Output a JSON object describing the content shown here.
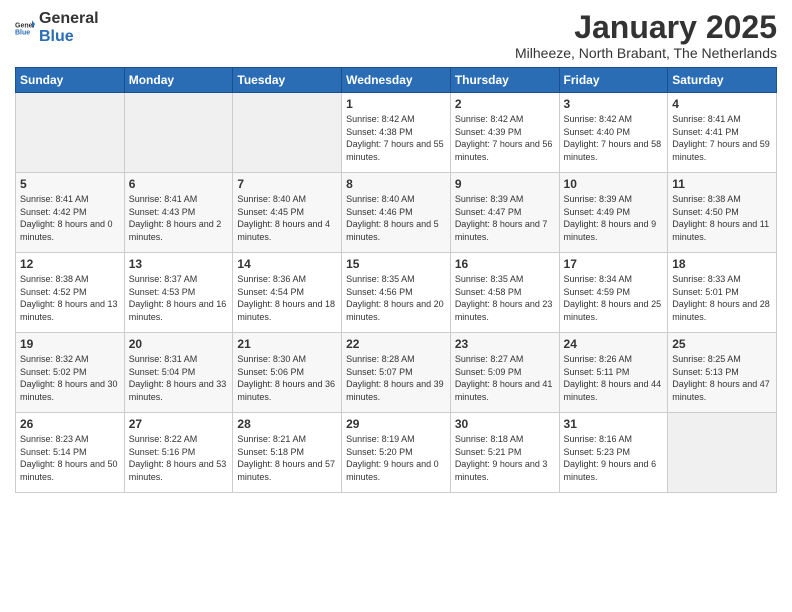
{
  "logo": {
    "general": "General",
    "blue": "Blue"
  },
  "header": {
    "month": "January 2025",
    "location": "Milheeze, North Brabant, The Netherlands"
  },
  "weekdays": [
    "Sunday",
    "Monday",
    "Tuesday",
    "Wednesday",
    "Thursday",
    "Friday",
    "Saturday"
  ],
  "weeks": [
    [
      {
        "day": "",
        "sunrise": "",
        "sunset": "",
        "daylight": ""
      },
      {
        "day": "",
        "sunrise": "",
        "sunset": "",
        "daylight": ""
      },
      {
        "day": "",
        "sunrise": "",
        "sunset": "",
        "daylight": ""
      },
      {
        "day": "1",
        "sunrise": "Sunrise: 8:42 AM",
        "sunset": "Sunset: 4:38 PM",
        "daylight": "Daylight: 7 hours and 55 minutes."
      },
      {
        "day": "2",
        "sunrise": "Sunrise: 8:42 AM",
        "sunset": "Sunset: 4:39 PM",
        "daylight": "Daylight: 7 hours and 56 minutes."
      },
      {
        "day": "3",
        "sunrise": "Sunrise: 8:42 AM",
        "sunset": "Sunset: 4:40 PM",
        "daylight": "Daylight: 7 hours and 58 minutes."
      },
      {
        "day": "4",
        "sunrise": "Sunrise: 8:41 AM",
        "sunset": "Sunset: 4:41 PM",
        "daylight": "Daylight: 7 hours and 59 minutes."
      }
    ],
    [
      {
        "day": "5",
        "sunrise": "Sunrise: 8:41 AM",
        "sunset": "Sunset: 4:42 PM",
        "daylight": "Daylight: 8 hours and 0 minutes."
      },
      {
        "day": "6",
        "sunrise": "Sunrise: 8:41 AM",
        "sunset": "Sunset: 4:43 PM",
        "daylight": "Daylight: 8 hours and 2 minutes."
      },
      {
        "day": "7",
        "sunrise": "Sunrise: 8:40 AM",
        "sunset": "Sunset: 4:45 PM",
        "daylight": "Daylight: 8 hours and 4 minutes."
      },
      {
        "day": "8",
        "sunrise": "Sunrise: 8:40 AM",
        "sunset": "Sunset: 4:46 PM",
        "daylight": "Daylight: 8 hours and 5 minutes."
      },
      {
        "day": "9",
        "sunrise": "Sunrise: 8:39 AM",
        "sunset": "Sunset: 4:47 PM",
        "daylight": "Daylight: 8 hours and 7 minutes."
      },
      {
        "day": "10",
        "sunrise": "Sunrise: 8:39 AM",
        "sunset": "Sunset: 4:49 PM",
        "daylight": "Daylight: 8 hours and 9 minutes."
      },
      {
        "day": "11",
        "sunrise": "Sunrise: 8:38 AM",
        "sunset": "Sunset: 4:50 PM",
        "daylight": "Daylight: 8 hours and 11 minutes."
      }
    ],
    [
      {
        "day": "12",
        "sunrise": "Sunrise: 8:38 AM",
        "sunset": "Sunset: 4:52 PM",
        "daylight": "Daylight: 8 hours and 13 minutes."
      },
      {
        "day": "13",
        "sunrise": "Sunrise: 8:37 AM",
        "sunset": "Sunset: 4:53 PM",
        "daylight": "Daylight: 8 hours and 16 minutes."
      },
      {
        "day": "14",
        "sunrise": "Sunrise: 8:36 AM",
        "sunset": "Sunset: 4:54 PM",
        "daylight": "Daylight: 8 hours and 18 minutes."
      },
      {
        "day": "15",
        "sunrise": "Sunrise: 8:35 AM",
        "sunset": "Sunset: 4:56 PM",
        "daylight": "Daylight: 8 hours and 20 minutes."
      },
      {
        "day": "16",
        "sunrise": "Sunrise: 8:35 AM",
        "sunset": "Sunset: 4:58 PM",
        "daylight": "Daylight: 8 hours and 23 minutes."
      },
      {
        "day": "17",
        "sunrise": "Sunrise: 8:34 AM",
        "sunset": "Sunset: 4:59 PM",
        "daylight": "Daylight: 8 hours and 25 minutes."
      },
      {
        "day": "18",
        "sunrise": "Sunrise: 8:33 AM",
        "sunset": "Sunset: 5:01 PM",
        "daylight": "Daylight: 8 hours and 28 minutes."
      }
    ],
    [
      {
        "day": "19",
        "sunrise": "Sunrise: 8:32 AM",
        "sunset": "Sunset: 5:02 PM",
        "daylight": "Daylight: 8 hours and 30 minutes."
      },
      {
        "day": "20",
        "sunrise": "Sunrise: 8:31 AM",
        "sunset": "Sunset: 5:04 PM",
        "daylight": "Daylight: 8 hours and 33 minutes."
      },
      {
        "day": "21",
        "sunrise": "Sunrise: 8:30 AM",
        "sunset": "Sunset: 5:06 PM",
        "daylight": "Daylight: 8 hours and 36 minutes."
      },
      {
        "day": "22",
        "sunrise": "Sunrise: 8:28 AM",
        "sunset": "Sunset: 5:07 PM",
        "daylight": "Daylight: 8 hours and 39 minutes."
      },
      {
        "day": "23",
        "sunrise": "Sunrise: 8:27 AM",
        "sunset": "Sunset: 5:09 PM",
        "daylight": "Daylight: 8 hours and 41 minutes."
      },
      {
        "day": "24",
        "sunrise": "Sunrise: 8:26 AM",
        "sunset": "Sunset: 5:11 PM",
        "daylight": "Daylight: 8 hours and 44 minutes."
      },
      {
        "day": "25",
        "sunrise": "Sunrise: 8:25 AM",
        "sunset": "Sunset: 5:13 PM",
        "daylight": "Daylight: 8 hours and 47 minutes."
      }
    ],
    [
      {
        "day": "26",
        "sunrise": "Sunrise: 8:23 AM",
        "sunset": "Sunset: 5:14 PM",
        "daylight": "Daylight: 8 hours and 50 minutes."
      },
      {
        "day": "27",
        "sunrise": "Sunrise: 8:22 AM",
        "sunset": "Sunset: 5:16 PM",
        "daylight": "Daylight: 8 hours and 53 minutes."
      },
      {
        "day": "28",
        "sunrise": "Sunrise: 8:21 AM",
        "sunset": "Sunset: 5:18 PM",
        "daylight": "Daylight: 8 hours and 57 minutes."
      },
      {
        "day": "29",
        "sunrise": "Sunrise: 8:19 AM",
        "sunset": "Sunset: 5:20 PM",
        "daylight": "Daylight: 9 hours and 0 minutes."
      },
      {
        "day": "30",
        "sunrise": "Sunrise: 8:18 AM",
        "sunset": "Sunset: 5:21 PM",
        "daylight": "Daylight: 9 hours and 3 minutes."
      },
      {
        "day": "31",
        "sunrise": "Sunrise: 8:16 AM",
        "sunset": "Sunset: 5:23 PM",
        "daylight": "Daylight: 9 hours and 6 minutes."
      },
      {
        "day": "",
        "sunrise": "",
        "sunset": "",
        "daylight": ""
      }
    ]
  ]
}
